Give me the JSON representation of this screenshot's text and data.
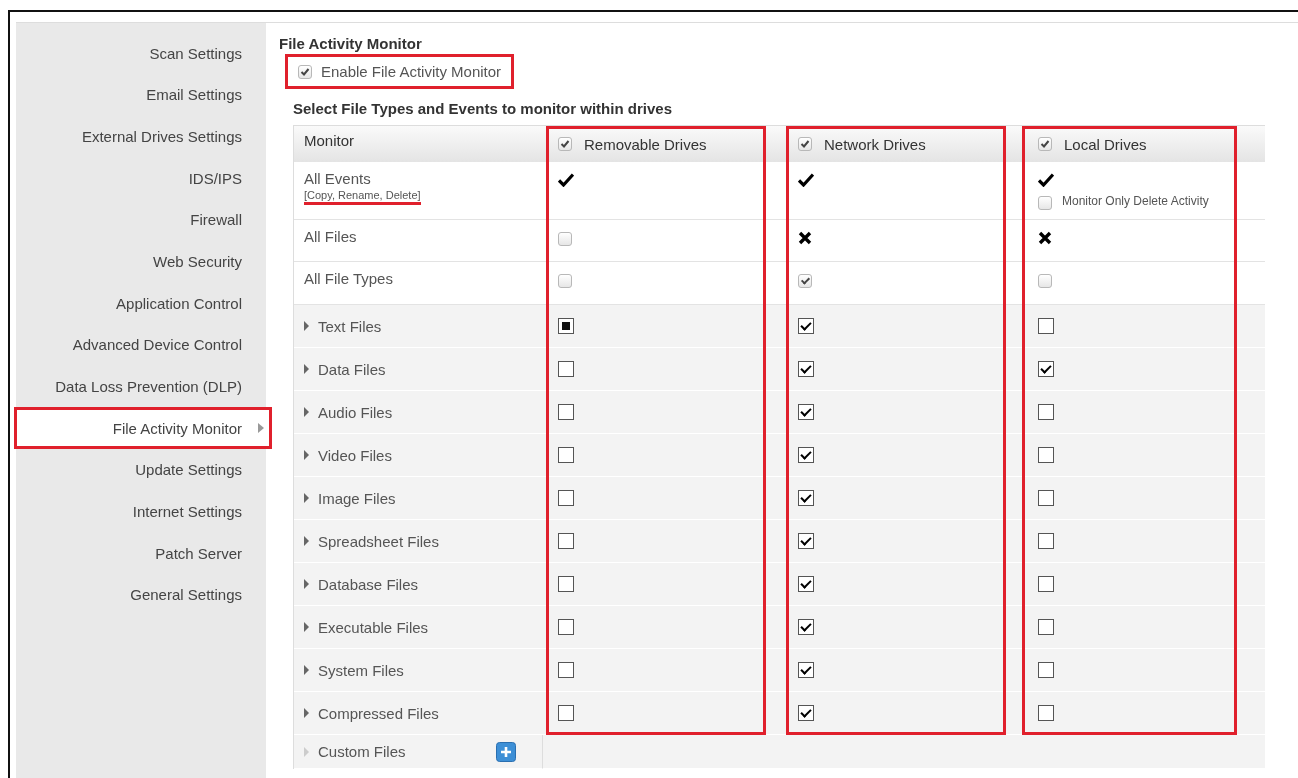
{
  "sidebar": {
    "items": [
      {
        "label": "Scan Settings",
        "selected": false,
        "highlighted": false
      },
      {
        "label": "Email Settings",
        "selected": false,
        "highlighted": false
      },
      {
        "label": "External Drives Settings",
        "selected": false,
        "highlighted": false
      },
      {
        "label": "IDS/IPS",
        "selected": false,
        "highlighted": false
      },
      {
        "label": "Firewall",
        "selected": false,
        "highlighted": false
      },
      {
        "label": "Web Security",
        "selected": false,
        "highlighted": false
      },
      {
        "label": "Application Control",
        "selected": false,
        "highlighted": false
      },
      {
        "label": "Advanced Device Control",
        "selected": false,
        "highlighted": false
      },
      {
        "label": "Data Loss Prevention (DLP)",
        "selected": false,
        "highlighted": false
      },
      {
        "label": "File Activity Monitor",
        "selected": true,
        "highlighted": true
      },
      {
        "label": "Update Settings",
        "selected": false,
        "highlighted": false
      },
      {
        "label": "Internet Settings",
        "selected": false,
        "highlighted": false
      },
      {
        "label": "Patch Server",
        "selected": false,
        "highlighted": false
      },
      {
        "label": "General Settings",
        "selected": false,
        "highlighted": false
      }
    ]
  },
  "main": {
    "title": "File Activity Monitor",
    "enable": {
      "label": "Enable File Activity Monitor",
      "checked": true,
      "highlighted": true
    },
    "subtitle": "Select File Types and Events to monitor within drives",
    "table": {
      "monitor_header": "Monitor",
      "columns": [
        {
          "label": "Removable Drives",
          "checked": true,
          "highlighted": true
        },
        {
          "label": "Network Drives",
          "checked": true,
          "highlighted": true
        },
        {
          "label": "Local Drives",
          "checked": true,
          "highlighted": true
        }
      ],
      "rows": [
        {
          "kind": "event",
          "label": "All Events",
          "note": "[Copy, Rename, Delete]",
          "note_underlined": true,
          "cells": [
            {
              "kind": "tick"
            },
            {
              "kind": "tick"
            },
            {
              "kind": "tick",
              "option": {
                "label": "Monitor Only Delete Activity",
                "checked": false
              }
            }
          ]
        },
        {
          "kind": "plain",
          "label": "All Files",
          "cells": [
            {
              "kind": "checkbox",
              "checked": false,
              "disabled": true
            },
            {
              "kind": "cross"
            },
            {
              "kind": "cross"
            }
          ]
        },
        {
          "kind": "plain",
          "label": "All File Types",
          "cells": [
            {
              "kind": "checkbox",
              "checked": false,
              "disabled": true
            },
            {
              "kind": "checkbox",
              "checked": true,
              "disabled": true
            },
            {
              "kind": "checkbox",
              "checked": false,
              "disabled": true
            }
          ]
        },
        {
          "kind": "filetype",
          "label": "Text Files",
          "cells": [
            {
              "kind": "partial"
            },
            {
              "kind": "checkbox",
              "checked": true,
              "disabled": false
            },
            {
              "kind": "checkbox",
              "checked": false,
              "disabled": false
            }
          ]
        },
        {
          "kind": "filetype",
          "label": "Data Files",
          "cells": [
            {
              "kind": "checkbox",
              "checked": false,
              "disabled": false
            },
            {
              "kind": "checkbox",
              "checked": true,
              "disabled": false
            },
            {
              "kind": "checkbox",
              "checked": true,
              "disabled": false
            }
          ]
        },
        {
          "kind": "filetype",
          "label": "Audio Files",
          "cells": [
            {
              "kind": "checkbox",
              "checked": false,
              "disabled": false
            },
            {
              "kind": "checkbox",
              "checked": true,
              "disabled": false
            },
            {
              "kind": "checkbox",
              "checked": false,
              "disabled": false
            }
          ]
        },
        {
          "kind": "filetype",
          "label": "Video Files",
          "cells": [
            {
              "kind": "checkbox",
              "checked": false,
              "disabled": false
            },
            {
              "kind": "checkbox",
              "checked": true,
              "disabled": false
            },
            {
              "kind": "checkbox",
              "checked": false,
              "disabled": false
            }
          ]
        },
        {
          "kind": "filetype",
          "label": "Image Files",
          "cells": [
            {
              "kind": "checkbox",
              "checked": false,
              "disabled": false
            },
            {
              "kind": "checkbox",
              "checked": true,
              "disabled": false
            },
            {
              "kind": "checkbox",
              "checked": false,
              "disabled": false
            }
          ]
        },
        {
          "kind": "filetype",
          "label": "Spreadsheet Files",
          "cells": [
            {
              "kind": "checkbox",
              "checked": false,
              "disabled": false
            },
            {
              "kind": "checkbox",
              "checked": true,
              "disabled": false
            },
            {
              "kind": "checkbox",
              "checked": false,
              "disabled": false
            }
          ]
        },
        {
          "kind": "filetype",
          "label": "Database Files",
          "cells": [
            {
              "kind": "checkbox",
              "checked": false,
              "disabled": false
            },
            {
              "kind": "checkbox",
              "checked": true,
              "disabled": false
            },
            {
              "kind": "checkbox",
              "checked": false,
              "disabled": false
            }
          ]
        },
        {
          "kind": "filetype",
          "label": "Executable Files",
          "cells": [
            {
              "kind": "checkbox",
              "checked": false,
              "disabled": false
            },
            {
              "kind": "checkbox",
              "checked": true,
              "disabled": false
            },
            {
              "kind": "checkbox",
              "checked": false,
              "disabled": false
            }
          ]
        },
        {
          "kind": "filetype",
          "label": "System Files",
          "cells": [
            {
              "kind": "checkbox",
              "checked": false,
              "disabled": false
            },
            {
              "kind": "checkbox",
              "checked": true,
              "disabled": false
            },
            {
              "kind": "checkbox",
              "checked": false,
              "disabled": false
            }
          ]
        },
        {
          "kind": "filetype",
          "label": "Compressed Files",
          "cells": [
            {
              "kind": "checkbox",
              "checked": false,
              "disabled": false
            },
            {
              "kind": "checkbox",
              "checked": true,
              "disabled": false
            },
            {
              "kind": "checkbox",
              "checked": false,
              "disabled": false
            }
          ]
        },
        {
          "kind": "custom",
          "label": "Custom Files"
        }
      ]
    }
  }
}
